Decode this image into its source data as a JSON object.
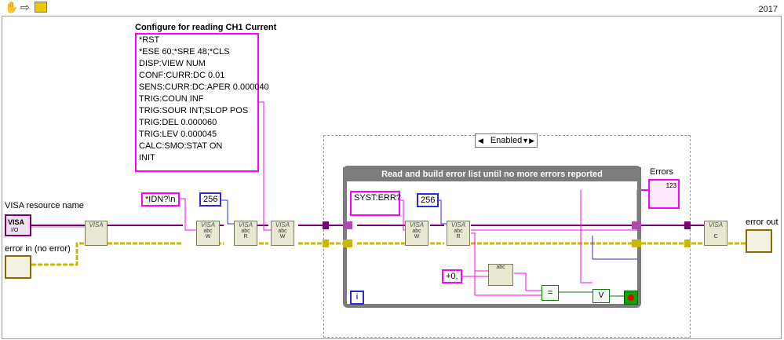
{
  "toolbar": {
    "icons": [
      "hand-icon",
      "arrow-icon",
      "run-icon"
    ],
    "version": "2017"
  },
  "command_block": {
    "title": "Configure for reading CH1 Current",
    "lines": [
      "*RST",
      "*ESE 60;*SRE 48;*CLS",
      "DISP:VIEW NUM",
      "CONF:CURR:DC 0.01",
      "SENS:CURR:DC:APER 0.000040",
      "TRIG:COUN INF",
      "TRIG:SOUR INT;SLOP POS",
      "TRIG:DEL 0.000060",
      "TRIG:LEV 0.000045",
      "CALC:SMO:STAT ON",
      "INIT"
    ]
  },
  "inputs": {
    "visa_label": "VISA resource name",
    "visa_icon_text": "VISA",
    "visa_sub": "I/O",
    "error_in_label": "error in (no error)"
  },
  "constants": {
    "idn": "*IDN?\\n",
    "count_256_a": "256",
    "syst_err": "SYST:ERR?",
    "count_256_b": "256",
    "plus_zero": "+0,"
  },
  "nodes": {
    "visa": "VISA",
    "write_w": "W",
    "read_r": "R",
    "close_c": "C",
    "abc": "abc"
  },
  "diagram_disable": {
    "selector_label": "Enabled"
  },
  "while_loop": {
    "title": "Read and build error list until no more errors reported",
    "iteration": "i",
    "equal_symbol": "=",
    "or_symbol": "V"
  },
  "outputs": {
    "errors_label": "Errors",
    "errors_array_text": "123",
    "error_out_label": "error out"
  },
  "colors": {
    "string_wire": "#ff00ff",
    "int_wire": "#2b2bd6",
    "error_wire": "#c9b800",
    "visa_wire": "#7a007a",
    "loop_border": "#7c7c7c"
  }
}
